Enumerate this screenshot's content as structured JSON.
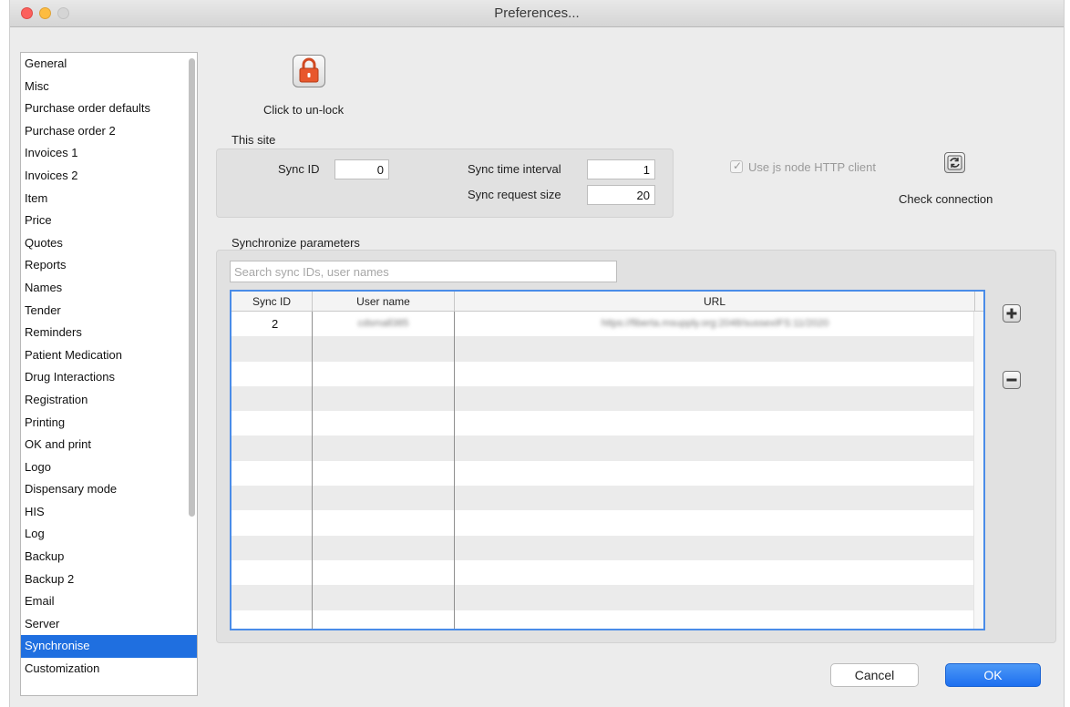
{
  "window": {
    "title": "Preferences..."
  },
  "sidebar": {
    "items": [
      "General",
      "Misc",
      "Purchase order defaults",
      "Purchase order 2",
      "Invoices 1",
      "Invoices 2",
      "Item",
      "Price",
      "Quotes",
      "Reports",
      "Names",
      "Tender",
      "Reminders",
      "Patient Medication",
      "Drug Interactions",
      "Registration",
      "Printing",
      "OK and print",
      "Logo",
      "Dispensary mode",
      "HIS",
      "Log",
      "Backup",
      "Backup 2",
      "Email",
      "Server",
      "Synchronise",
      "Customization"
    ],
    "selected": "Synchronise"
  },
  "lock": {
    "caption": "Click to un-lock",
    "icon": "lock-icon",
    "color": "#e8572c"
  },
  "this_site": {
    "label": "This site",
    "sync_id_label": "Sync ID",
    "sync_id_value": "0",
    "sync_time_interval_label": "Sync time interval",
    "sync_time_interval_value": "1",
    "sync_request_size_label": "Sync request size",
    "sync_request_size_value": "20"
  },
  "js_node": {
    "label": "Use js node HTTP client",
    "checked": true
  },
  "check_connection": {
    "label": "Check connection",
    "icon": "sync-icon"
  },
  "sync_params": {
    "label": "Synchronize parameters",
    "search_placeholder": "Search sync IDs, user names",
    "columns": [
      "Sync ID",
      "User name",
      "URL"
    ],
    "rows": [
      {
        "sync_id": "2",
        "user_name": "cdsmall385",
        "url": "https://fiberta.msupply.org:2048/sussexIFS:11/2020"
      }
    ]
  },
  "buttons": {
    "cancel": "Cancel",
    "ok": "OK"
  },
  "colors": {
    "accent": "#1f6fe0",
    "ok_button": "#2f7ff2"
  }
}
